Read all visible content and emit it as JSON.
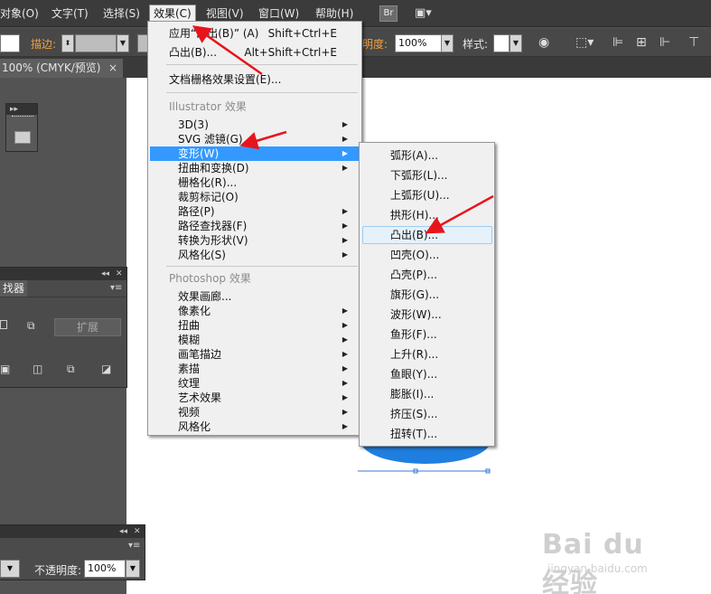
{
  "menubar": {
    "items": [
      "对象(O)",
      "文字(T)",
      "选择(S)",
      "效果(C)",
      "视图(V)",
      "窗口(W)",
      "帮助(H)"
    ],
    "active_index": 3,
    "bridge_button": "Br"
  },
  "controlbar": {
    "stroke_label": "描边:",
    "opacity_label": "明度:",
    "opacity_value": "100%",
    "style_label": "样式:"
  },
  "document_tab": {
    "label": "100% (CMYK/预览)",
    "close": "×"
  },
  "pathfinder_panel": {
    "tab_label": "找器",
    "expand_button": "扩展"
  },
  "bottom_panel": {
    "opacity_label": "不透明度:",
    "opacity_value": "100%"
  },
  "effect_menu": {
    "apply_last": {
      "label": "应用“凸出(B)” (A)",
      "shortcut": "Shift+Ctrl+E"
    },
    "last_effect": {
      "label": "凸出(B)...",
      "shortcut": "Alt+Shift+Ctrl+E"
    },
    "raster_settings": "文档栅格效果设置(E)...",
    "illustrator_header": "Illustrator 效果",
    "illustrator_items": [
      {
        "label": "3D(3)",
        "submenu": true
      },
      {
        "label": "SVG 滤镜(G)",
        "submenu": true
      },
      {
        "label": "变形(W)",
        "submenu": true,
        "highlighted": true
      },
      {
        "label": "扭曲和变换(D)",
        "submenu": true
      },
      {
        "label": "栅格化(R)...",
        "submenu": false
      },
      {
        "label": "裁剪标记(O)",
        "submenu": false
      },
      {
        "label": "路径(P)",
        "submenu": true
      },
      {
        "label": "路径查找器(F)",
        "submenu": true
      },
      {
        "label": "转换为形状(V)",
        "submenu": true
      },
      {
        "label": "风格化(S)",
        "submenu": true
      }
    ],
    "photoshop_header": "Photoshop 效果",
    "photoshop_items": [
      {
        "label": "效果画廊...",
        "submenu": false
      },
      {
        "label": "像素化",
        "submenu": true
      },
      {
        "label": "扭曲",
        "submenu": true
      },
      {
        "label": "模糊",
        "submenu": true
      },
      {
        "label": "画笔描边",
        "submenu": true
      },
      {
        "label": "素描",
        "submenu": true
      },
      {
        "label": "纹理",
        "submenu": true
      },
      {
        "label": "艺术效果",
        "submenu": true
      },
      {
        "label": "视频",
        "submenu": true
      },
      {
        "label": "风格化",
        "submenu": true
      }
    ]
  },
  "warp_submenu": {
    "items": [
      "弧形(A)...",
      "下弧形(L)...",
      "上弧形(U)...",
      "拱形(H)...",
      "凸出(B)...",
      "凹壳(O)...",
      "凸壳(P)...",
      "旗形(G)...",
      "波形(W)...",
      "鱼形(F)...",
      "上升(R)...",
      "鱼眼(Y)...",
      "膨胀(I)...",
      "挤压(S)...",
      "扭转(T)..."
    ],
    "hover_index": 4
  },
  "watermark": {
    "logo": "Bai du 经验",
    "url": "jingyan.baidu.com"
  },
  "colors": {
    "menu_highlight": "#3399ff",
    "arrow": "#e8141c",
    "shape_blue": "#1f7fe0"
  }
}
